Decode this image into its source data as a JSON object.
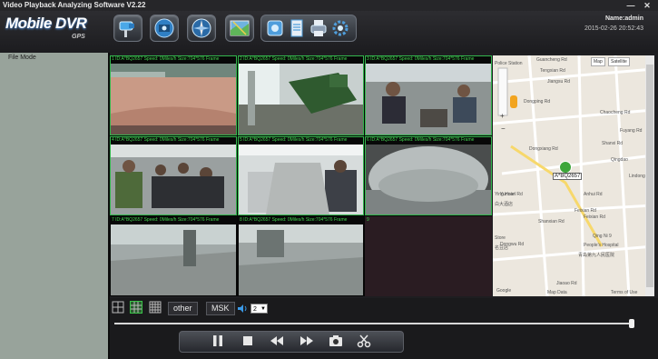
{
  "window": {
    "title": "Video Playback Analyzing Software V2.22",
    "minimize": "—",
    "close": "✕"
  },
  "logo": {
    "main": "Mobile DVR",
    "sub": "GPS"
  },
  "user": {
    "name_label": "Name:admin",
    "datetime": "2015-02-26 20:52:43"
  },
  "left_panel": {
    "title": "File Mode"
  },
  "cells": [
    {
      "label": "1  ID:A*BQ2657 Speed: 0Miles/h  Size:704*576  Frame"
    },
    {
      "label": "2  ID:A*BQ2657 Speed: 0Miles/h  Size:704*576  Frame"
    },
    {
      "label": "3  ID:A*BQ2657 Speed: 0Miles/h  Size:704*576  Frame"
    },
    {
      "label": "4  ID:A*BQ2657 Speed: 0Miles/h  Size:704*576  Frame"
    },
    {
      "label": "5  ID:A*BQ2657 Speed: 0Miles/h  Size:704*576  Frame"
    },
    {
      "label": "6  ID:A*BQ2657 Speed: 0Miles/h  Size:704*576  Frame"
    },
    {
      "label": "7  ID:A*BQ2657 Speed: 0Miles/h  Size:704*576  Frame"
    },
    {
      "label": "8  ID:A*BQ2657 Speed: 0Miles/h  Size:704*576  Frame"
    },
    {
      "label": "9"
    }
  ],
  "map": {
    "map_btn": "Map",
    "sat_btn": "Satellite",
    "vehicle": "A*BQ2657",
    "labels": [
      "Police Station",
      "Guancheng Rd",
      "Tengxian Rd",
      "Dongping Rd",
      "Jiangsu Rd",
      "Chaocheng Rd",
      "Fuyang Rd",
      "Dongxiang Rd",
      "Shanxi Rd",
      "Qingdao",
      "Anhui Rd",
      "Feixian Rd",
      "Dongwu Rd",
      "Yunnan Rd",
      "Lindong Rd",
      "Ying Hotel",
      "白大酒店",
      "Shanxian Rd",
      "Feixian Rd",
      "Qing Ni 9",
      "People's Hospital",
      "青岛第九人民医院",
      "Store",
      "名豆店",
      "Jiaoao Rd",
      "Google",
      "Map Data",
      "Terms of Use"
    ],
    "zoom_in": "+",
    "zoom_out": "−"
  },
  "layout_buttons": {
    "other": "other",
    "msk": "MSK",
    "channel": "2"
  },
  "playback": {
    "progress_percent": 99
  }
}
